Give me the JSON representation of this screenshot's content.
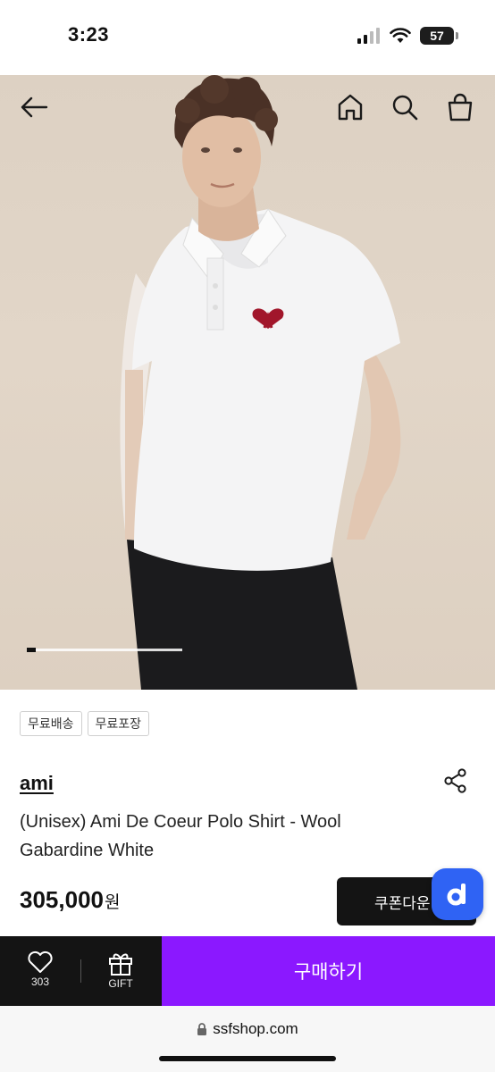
{
  "status": {
    "time": "3:23",
    "battery": "57"
  },
  "tags": [
    "무료배송",
    "무료포장"
  ],
  "product": {
    "brand": "ami",
    "name": "(Unisex) Ami De Coeur Polo Shirt - Wool Gabardine White",
    "price": "305,000",
    "currency": "원",
    "coupon_label": "쿠폰다운"
  },
  "gallery": {
    "current_page": 1
  },
  "action_bar": {
    "wish_count": "303",
    "gift_label": "GIFT",
    "buy_label": "구매하기"
  },
  "browser": {
    "url": "ssfshop.com"
  },
  "colors": {
    "buy_button": "#8b18ff",
    "floating_badge": "#2f63f4",
    "logo_heart": "#a1162b"
  },
  "icons": [
    "back-arrow-icon",
    "home-icon",
    "search-icon",
    "shopping-bag-icon",
    "share-icon",
    "heart-icon",
    "gift-icon",
    "lock-icon"
  ]
}
